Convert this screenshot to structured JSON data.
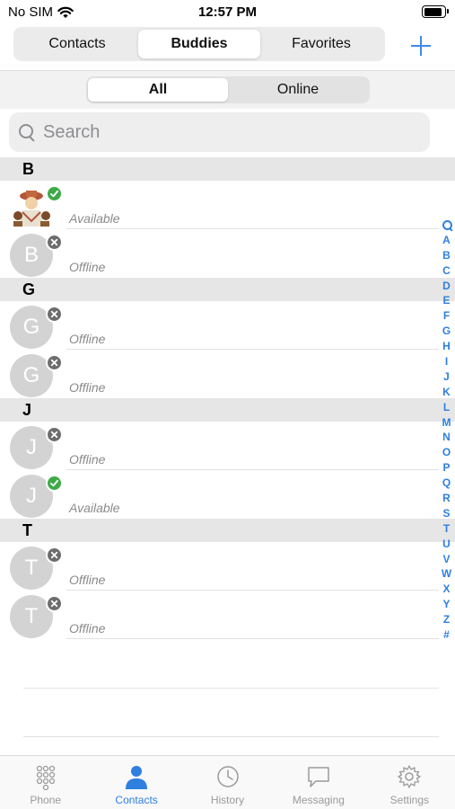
{
  "status_bar": {
    "carrier": "No SIM",
    "time": "12:57 PM"
  },
  "top_tabs": [
    {
      "label": "Contacts",
      "active": false
    },
    {
      "label": "Buddies",
      "active": true
    },
    {
      "label": "Favorites",
      "active": false
    }
  ],
  "filter_tabs": [
    {
      "label": "All",
      "active": true
    },
    {
      "label": "Online",
      "active": false
    }
  ],
  "search": {
    "placeholder": "Search"
  },
  "sections": [
    {
      "letter": "B",
      "contacts": [
        {
          "initial": "",
          "has_photo": true,
          "status": "Available"
        },
        {
          "initial": "B",
          "has_photo": false,
          "status": "Offline"
        }
      ]
    },
    {
      "letter": "G",
      "contacts": [
        {
          "initial": "G",
          "has_photo": false,
          "status": "Offline"
        },
        {
          "initial": "G",
          "has_photo": false,
          "status": "Offline"
        }
      ]
    },
    {
      "letter": "J",
      "contacts": [
        {
          "initial": "J",
          "has_photo": false,
          "status": "Offline"
        },
        {
          "initial": "J",
          "has_photo": false,
          "status": "Available"
        }
      ]
    },
    {
      "letter": "T",
      "contacts": [
        {
          "initial": "T",
          "has_photo": false,
          "status": "Offline"
        },
        {
          "initial": "T",
          "has_photo": false,
          "status": "Offline"
        }
      ]
    }
  ],
  "index_letters": [
    "A",
    "B",
    "C",
    "D",
    "E",
    "F",
    "G",
    "H",
    "I",
    "J",
    "K",
    "L",
    "M",
    "N",
    "O",
    "P",
    "Q",
    "R",
    "S",
    "T",
    "U",
    "V",
    "W",
    "X",
    "Y",
    "Z",
    "#"
  ],
  "tab_bar": [
    {
      "label": "Phone",
      "icon": "keypad-icon",
      "active": false
    },
    {
      "label": "Contacts",
      "icon": "person-icon",
      "active": true
    },
    {
      "label": "History",
      "icon": "clock-icon",
      "active": false
    },
    {
      "label": "Messaging",
      "icon": "chat-bubble-icon",
      "active": false
    },
    {
      "label": "Settings",
      "icon": "gear-icon",
      "active": false
    }
  ],
  "colors": {
    "accent": "#2f7fe0",
    "online": "#3daa46",
    "offline": "#6d6d6d"
  }
}
